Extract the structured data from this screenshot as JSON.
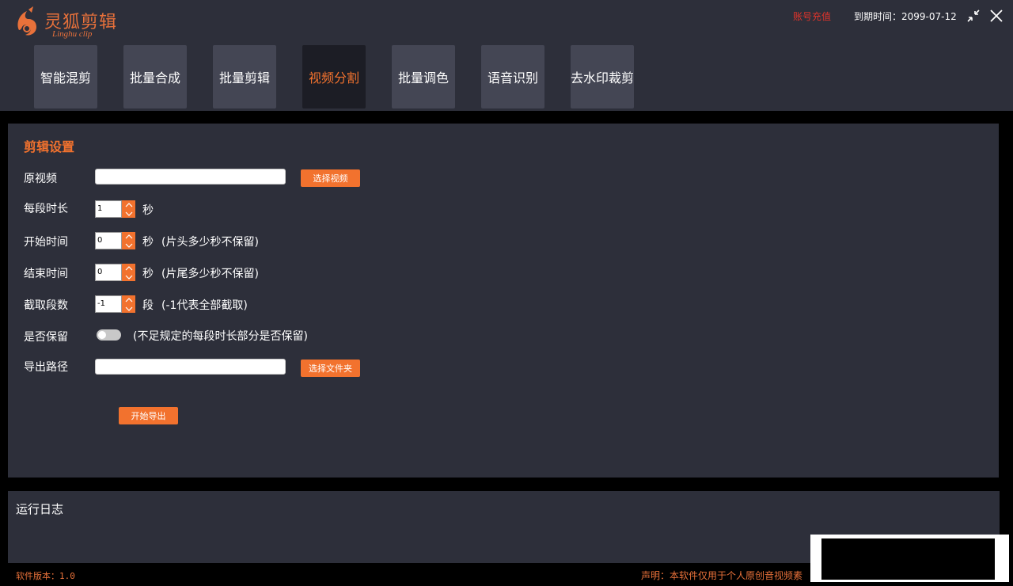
{
  "app": {
    "logo_title": "灵狐剪辑",
    "logo_subtitle": "Linghu clip",
    "recharge_label": "账号充值",
    "expire_label": "到期时间：2099-07-12",
    "brand_color": "#f2722e"
  },
  "tabs": [
    {
      "label": "智能混剪",
      "active": false
    },
    {
      "label": "批量合成",
      "active": false
    },
    {
      "label": "批量剪辑",
      "active": false
    },
    {
      "label": "视频分割",
      "active": true
    },
    {
      "label": "批量调色",
      "active": false
    },
    {
      "label": "语音识别",
      "active": false
    },
    {
      "label": "去水印裁剪",
      "active": false
    }
  ],
  "settings": {
    "title": "剪辑设置",
    "source_video": {
      "label": "原视频",
      "value": "",
      "button": "选择视频"
    },
    "segment_length": {
      "label": "每段时长",
      "value": "1",
      "unit": "秒"
    },
    "start_time": {
      "label": "开始时间",
      "value": "0",
      "unit": "秒",
      "hint": "(片头多少秒不保留)"
    },
    "end_time": {
      "label": "结束时间",
      "value": "0",
      "unit": "秒",
      "hint": "(片尾多少秒不保留)"
    },
    "segment_count": {
      "label": "截取段数",
      "value": "-1",
      "unit": "段",
      "hint": "(-1代表全部截取)"
    },
    "keep_remainder": {
      "label": "是否保留",
      "on": false,
      "hint": "(不足规定的每段时长部分是否保留)"
    },
    "export_path": {
      "label": "导出路径",
      "value": "",
      "button": "选择文件夹"
    },
    "start_button": "开始导出"
  },
  "log": {
    "title": "运行日志"
  },
  "footer": {
    "version": "软件版本：1.0",
    "disclaimer": "声明：本软件仅用于个人原创音视频素"
  }
}
